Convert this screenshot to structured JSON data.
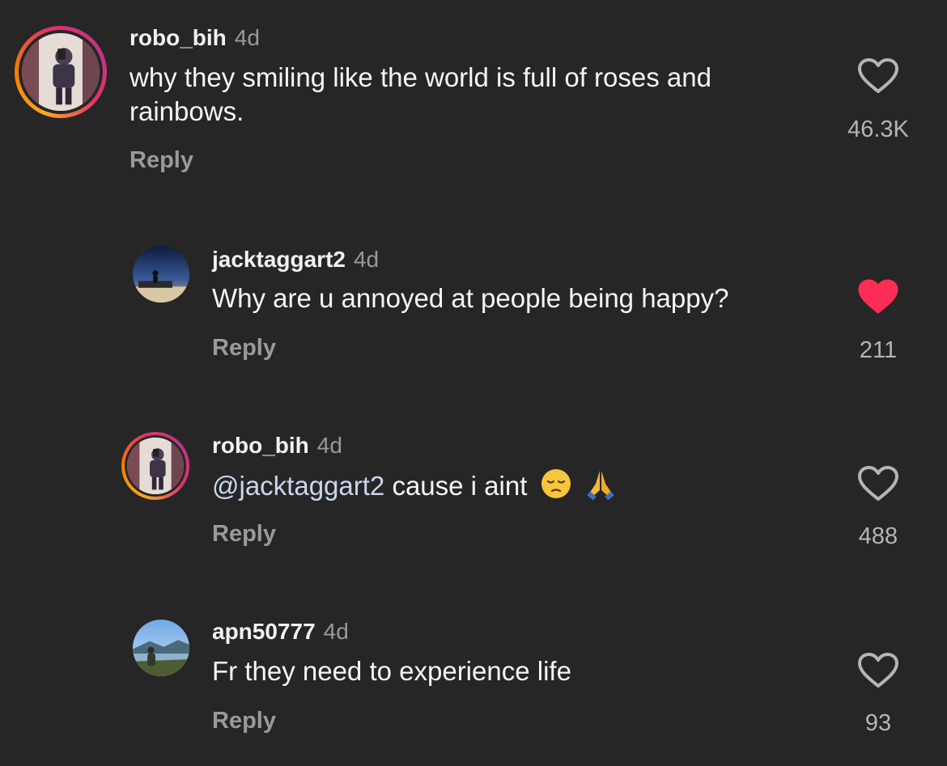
{
  "colors": {
    "background": "#262626",
    "like_active": "#ff2d55",
    "mention": "#c9d7ee",
    "muted": "#9a9a9a"
  },
  "comments": [
    {
      "username": "robo_bih",
      "time": "4d",
      "text": "why they smiling like the world is full of roses and rainbows.",
      "reply_label": "Reply",
      "likes": "46.3K",
      "liked": false,
      "avatar_icon": "mirror-selfie-avatar",
      "has_story_ring": true
    },
    {
      "username": "jacktaggart2",
      "time": "4d",
      "text": "Why are u annoyed at people being happy?",
      "reply_label": "Reply",
      "likes": "211",
      "liked": true,
      "avatar_icon": "sunset-silhouette-avatar",
      "has_story_ring": false
    },
    {
      "username": "robo_bih",
      "time": "4d",
      "mention": "@jacktaggart2",
      "text": "cause i aint",
      "emojis": [
        "pensive-face-emoji",
        "folded-hands-emoji"
      ],
      "reply_label": "Reply",
      "likes": "488",
      "liked": false,
      "avatar_icon": "mirror-selfie-avatar",
      "has_story_ring": true
    },
    {
      "username": "apn50777",
      "time": "4d",
      "text": "Fr they need to experience life",
      "reply_label": "Reply",
      "likes": "93",
      "liked": false,
      "avatar_icon": "lake-landscape-avatar",
      "has_story_ring": false
    }
  ]
}
